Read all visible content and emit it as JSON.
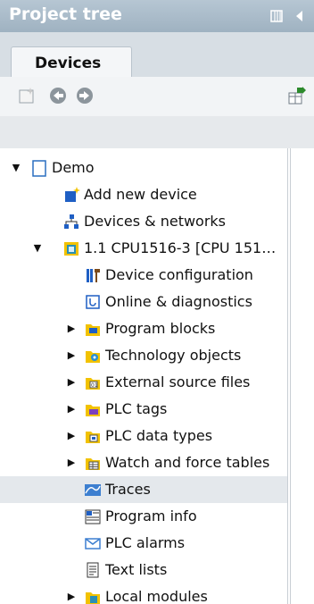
{
  "panel": {
    "title": "Project tree"
  },
  "tabs": {
    "devices": "Devices"
  },
  "tree": {
    "items": [
      {
        "label": "Demo",
        "icon": "project-icon",
        "expander": "▼",
        "level": 0
      },
      {
        "label": "Add new device",
        "icon": "add-device-icon",
        "expander": "",
        "level": 1
      },
      {
        "label": "Devices & networks",
        "icon": "network-icon",
        "expander": "",
        "level": 1
      },
      {
        "label": "1.1 CPU1516-3 [CPU 151…",
        "icon": "cpu-icon",
        "expander": "▼",
        "level": 1
      },
      {
        "label": "Device configuration",
        "icon": "device-config-icon",
        "expander": "",
        "level": 2
      },
      {
        "label": "Online & diagnostics",
        "icon": "diagnostics-icon",
        "expander": "",
        "level": 2
      },
      {
        "label": "Program blocks",
        "icon": "program-blocks-icon",
        "expander": "▶",
        "level": 2
      },
      {
        "label": "Technology objects",
        "icon": "technology-objects-icon",
        "expander": "▶",
        "level": 2
      },
      {
        "label": "External source files",
        "icon": "external-source-icon",
        "expander": "▶",
        "level": 2
      },
      {
        "label": "PLC tags",
        "icon": "plc-tags-icon",
        "expander": "▶",
        "level": 2
      },
      {
        "label": "PLC data types",
        "icon": "plc-data-types-icon",
        "expander": "▶",
        "level": 2
      },
      {
        "label": "Watch and force tables",
        "icon": "watch-tables-icon",
        "expander": "▶",
        "level": 2
      },
      {
        "label": "Traces",
        "icon": "traces-icon",
        "expander": "",
        "level": 2,
        "selected": true
      },
      {
        "label": "Program info",
        "icon": "program-info-icon",
        "expander": "",
        "level": 2
      },
      {
        "label": "PLC alarms",
        "icon": "plc-alarms-icon",
        "expander": "",
        "level": 2
      },
      {
        "label": "Text lists",
        "icon": "text-lists-icon",
        "expander": "",
        "level": 2
      },
      {
        "label": "Local modules",
        "icon": "local-modules-icon",
        "expander": "▶",
        "level": 2
      }
    ]
  }
}
